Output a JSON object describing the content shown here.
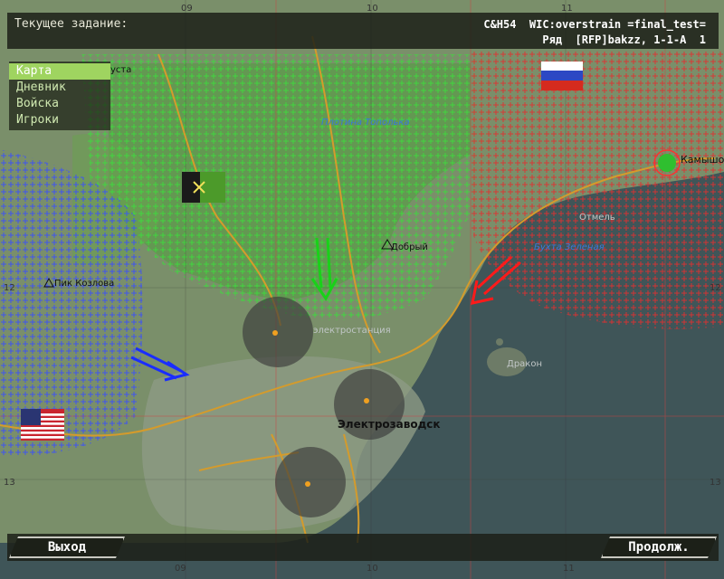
{
  "header": {
    "task_label": "Текущее задание:",
    "mission_line1": "C&H54  WIC:overstrain =final_test=",
    "mission_line2": "Ряд  [RFP]bakzz, 1-1-A  1"
  },
  "menu": {
    "items": [
      {
        "label": "Карта",
        "active": true
      },
      {
        "label": "Дневник",
        "active": false
      },
      {
        "label": "Войска",
        "active": false
      },
      {
        "label": "Игроки",
        "active": false
      }
    ]
  },
  "map": {
    "labels": {
      "ustya": "уста",
      "plotina": "Плотина Тополька",
      "dobry": "Добрый",
      "pik_kozlova": "Пик Козлова",
      "electrostation": "электростанция",
      "electrozavodsk": "Электрозаводск",
      "kamyshovo": "Камышо",
      "otmel": "Отмель",
      "bukhta": "Бухта Зеленая",
      "drakon": "Дракон"
    },
    "grid": {
      "top": [
        "09",
        "10",
        "11"
      ],
      "bottom": [
        "09",
        "10",
        "11"
      ],
      "left": [
        "12",
        "13"
      ],
      "right": [
        "12",
        "13"
      ]
    },
    "flags": [
      "russia-flag",
      "usa-flag",
      "objective-flag"
    ],
    "colors": {
      "blue_zone": "#3a4dff",
      "green_zone": "#3ddc3d",
      "red_zone": "#e23030",
      "blue_arrow": "#1a2dff",
      "green_arrow": "#19d119",
      "red_arrow": "#ff1a1a"
    }
  },
  "footer": {
    "exit_label": "Выход",
    "continue_label": "Продолж."
  }
}
